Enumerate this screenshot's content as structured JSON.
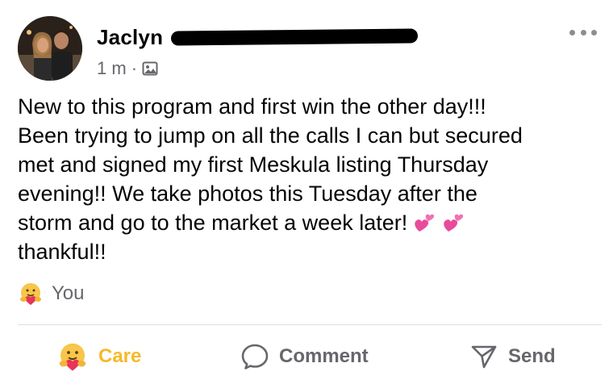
{
  "post": {
    "author": "Jaclyn",
    "timestamp": "1 m",
    "separator": "·",
    "audience_icon": "photo-audience-icon",
    "text_lines": [
      "New to this program and first win the other day!!!",
      "Been trying to jump on all the calls I can but secured",
      "met and signed my first Meskula listing Thursday",
      "evening!!  We take photos this Tuesday after the",
      "storm and go to the market a week later!",
      "thankful!!"
    ],
    "inline_emoji": [
      "two-hearts-icon",
      "two-hearts-icon"
    ]
  },
  "reactions": {
    "emoji": "care-emoji-icon",
    "label": "You"
  },
  "actions": {
    "care": {
      "label": "Care",
      "icon": "care-emoji-icon",
      "color": "#F7B928"
    },
    "comment": {
      "label": "Comment",
      "icon": "comment-bubble-icon"
    },
    "send": {
      "label": "Send",
      "icon": "send-icon"
    }
  },
  "colors": {
    "text": "#050505",
    "secondary": "#65676B",
    "divider": "#DDDFE2",
    "heart": "#E84B9B"
  }
}
